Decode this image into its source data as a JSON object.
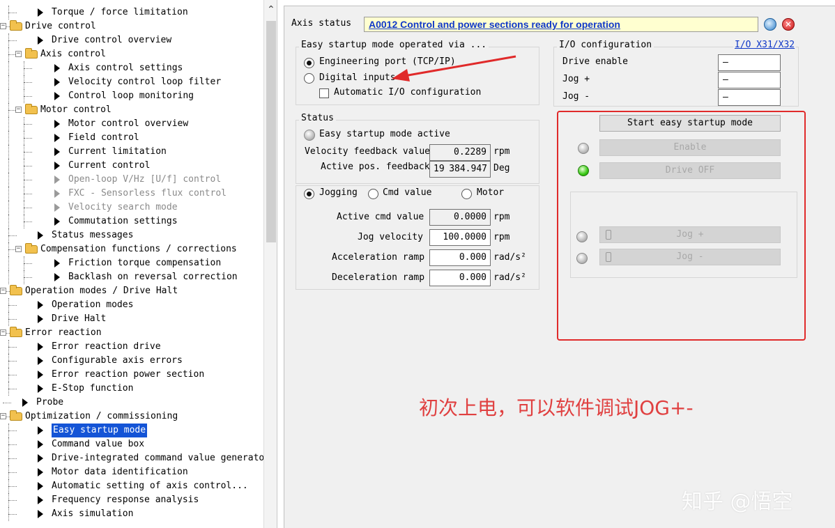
{
  "tree": [
    {
      "label": "Torque / force limitation",
      "level": 2,
      "kind": "leaf"
    },
    {
      "label": "Drive control",
      "level": 1,
      "kind": "folder"
    },
    {
      "label": "Drive control overview",
      "level": 2,
      "kind": "leaf"
    },
    {
      "label": "Axis control",
      "level": 2,
      "kind": "folder"
    },
    {
      "label": "Axis control settings",
      "level": 3,
      "kind": "leaf"
    },
    {
      "label": "Velocity control loop filter",
      "level": 3,
      "kind": "leaf"
    },
    {
      "label": "Control loop monitoring",
      "level": 3,
      "kind": "leaf"
    },
    {
      "label": "Motor control",
      "level": 2,
      "kind": "folder"
    },
    {
      "label": "Motor control overview",
      "level": 3,
      "kind": "leaf"
    },
    {
      "label": "Field control",
      "level": 3,
      "kind": "leaf"
    },
    {
      "label": "Current limitation",
      "level": 3,
      "kind": "leaf"
    },
    {
      "label": "Current control",
      "level": 3,
      "kind": "leaf"
    },
    {
      "label": "Open-loop V/Hz [U/f] control",
      "level": 3,
      "kind": "leaf",
      "disabled": true
    },
    {
      "label": "FXC - Sensorless flux control",
      "level": 3,
      "kind": "leaf",
      "disabled": true
    },
    {
      "label": "Velocity search mode",
      "level": 3,
      "kind": "leaf",
      "disabled": true
    },
    {
      "label": "Commutation settings",
      "level": 3,
      "kind": "leaf"
    },
    {
      "label": "Status messages",
      "level": 2,
      "kind": "leaf"
    },
    {
      "label": "Compensation functions / corrections",
      "level": 2,
      "kind": "folder"
    },
    {
      "label": "Friction torque compensation",
      "level": 3,
      "kind": "leaf"
    },
    {
      "label": "Backlash on reversal correction",
      "level": 3,
      "kind": "leaf"
    },
    {
      "label": "Operation modes / Drive Halt",
      "level": 1,
      "kind": "folder"
    },
    {
      "label": "Operation modes",
      "level": 2,
      "kind": "leaf"
    },
    {
      "label": "Drive Halt",
      "level": 2,
      "kind": "leaf"
    },
    {
      "label": "Error reaction",
      "level": 1,
      "kind": "folder"
    },
    {
      "label": "Error reaction drive",
      "level": 2,
      "kind": "leaf"
    },
    {
      "label": "Configurable axis errors",
      "level": 2,
      "kind": "leaf"
    },
    {
      "label": "Error reaction power section",
      "level": 2,
      "kind": "leaf"
    },
    {
      "label": "E-Stop function",
      "level": 2,
      "kind": "leaf"
    },
    {
      "label": "Probe",
      "level": 1,
      "kind": "leaf"
    },
    {
      "label": "Optimization / commissioning",
      "level": 1,
      "kind": "folder"
    },
    {
      "label": "Easy startup mode",
      "level": 2,
      "kind": "leaf",
      "selected": true
    },
    {
      "label": "Command value box",
      "level": 2,
      "kind": "leaf"
    },
    {
      "label": "Drive-integrated command value generator",
      "level": 2,
      "kind": "leaf"
    },
    {
      "label": "Motor data identification",
      "level": 2,
      "kind": "leaf"
    },
    {
      "label": "Automatic setting of axis control...",
      "level": 2,
      "kind": "leaf"
    },
    {
      "label": "Frequency response analysis",
      "level": 2,
      "kind": "leaf"
    },
    {
      "label": "Axis simulation",
      "level": 2,
      "kind": "leaf"
    }
  ],
  "axis_status": {
    "label": "Axis status",
    "value": "A0012 Control and power sections ready for operation"
  },
  "startup_via": {
    "title": "Easy startup mode operated via ...",
    "engineering_port": "Engineering port (TCP/IP)",
    "digital_inputs": "Digital inputs",
    "auto_io": "Automatic I/O configuration",
    "selected": "engineering_port"
  },
  "io_config": {
    "title": "I/O configuration",
    "link": "I/O X31/X32",
    "rows": [
      {
        "label": "Drive enable",
        "value": "—"
      },
      {
        "label": "Jog +",
        "value": "—"
      },
      {
        "label": "Jog -",
        "value": "—"
      }
    ]
  },
  "status": {
    "title": "Status",
    "easy_active": "Easy startup mode active",
    "velocity_label": "Velocity feedback value",
    "velocity_value": "0.2289",
    "velocity_unit": "rpm",
    "position_label": "Active pos. feedback",
    "position_prefix": "19",
    "position_value": "384.947",
    "position_unit": "Deg"
  },
  "mode": {
    "jogging": "Jogging",
    "cmd_value": "Cmd value",
    "motor": "Motor",
    "selected": "jogging"
  },
  "jog": {
    "rows": [
      {
        "label": "Active cmd value",
        "value": "0.0000",
        "unit": "rpm",
        "readonly": true
      },
      {
        "label": "Jog velocity",
        "value": "100.0000",
        "unit": "rpm",
        "readonly": false
      },
      {
        "label": "Acceleration ramp",
        "value": "0.000",
        "unit": "rad/s²",
        "readonly": false
      },
      {
        "label": "Deceleration ramp",
        "value": "0.000",
        "unit": "rad/s²",
        "readonly": false
      }
    ]
  },
  "control": {
    "start_button": "Start easy startup mode",
    "enable_button": "Enable",
    "drive_off_button": "Drive OFF",
    "jog_plus_button": "Jog +",
    "jog_minus_button": "Jog -"
  },
  "annotation": "初次上电，可以软件调试JOG+-",
  "watermark": "知乎 @悟空",
  "colors": {
    "annotation_red": "#e02a2a",
    "selection_blue": "#1454d6",
    "status_bg": "#ffffd0",
    "link_blue": "#1038c8"
  }
}
